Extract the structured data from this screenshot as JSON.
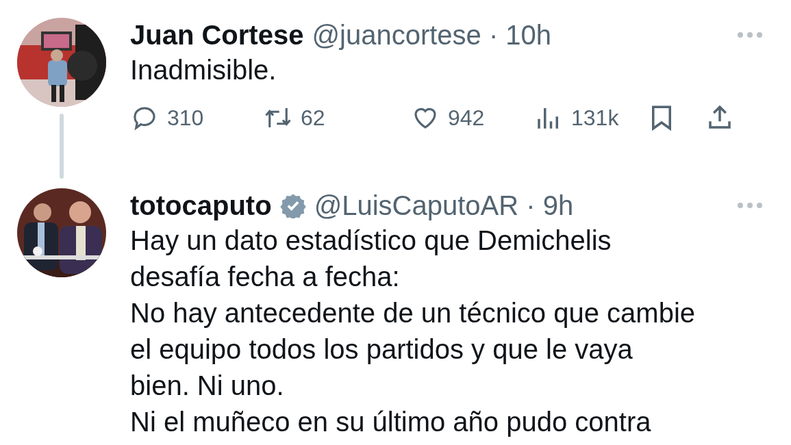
{
  "tweets": [
    {
      "name": "Juan Cortese",
      "handle": "@juancortese",
      "separator": "·",
      "time": "10h",
      "verified": false,
      "avatar": {
        "kind": "picture"
      },
      "paragraphs": [
        "Inadmisible."
      ],
      "actions": [
        {
          "kind": "reply",
          "count": "310"
        },
        {
          "kind": "retweet",
          "count": "62"
        },
        {
          "kind": "like",
          "count": "942"
        },
        {
          "kind": "views",
          "count": "131k"
        },
        {
          "kind": "bookmark"
        },
        {
          "kind": "share"
        }
      ]
    },
    {
      "name": "totocaputo",
      "handle": "@LuisCaputoAR",
      "separator": "·",
      "time": "9h",
      "verified": true,
      "avatar": {
        "kind": "picture"
      },
      "paragraphs": [
        "Hay un dato estadístico que Demichelis desafía fecha a fecha:",
        "No hay antecedente de un técnico que cambie el equipo todos los partidos y que le vaya bien. Ni uno.",
        "Ni el muñeco en su último año pudo contra"
      ]
    }
  ]
}
